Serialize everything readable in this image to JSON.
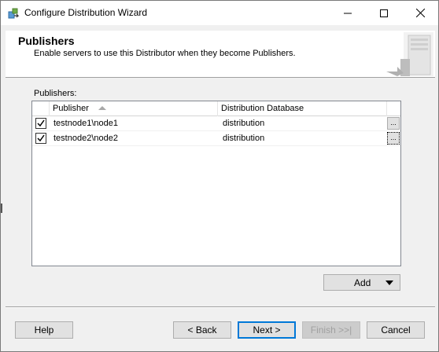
{
  "window": {
    "title": "Configure Distribution Wizard",
    "controls": [
      "minimize",
      "maximize",
      "close"
    ]
  },
  "header": {
    "title": "Publishers",
    "subtitle": "Enable servers to use this Distributor when they become Publishers."
  },
  "publishers_label": "Publishers:",
  "grid": {
    "columns": [
      "Publisher",
      "Distribution Database"
    ],
    "sort_column": "Publisher",
    "sort_direction": "ascending",
    "rows": [
      {
        "checked": true,
        "publisher": "testnode1\\node1",
        "database": "distribution",
        "ellipsis": "..."
      },
      {
        "checked": true,
        "publisher": "testnode2\\node2",
        "database": "distribution",
        "ellipsis": "..."
      }
    ]
  },
  "add_button": {
    "label": "Add"
  },
  "buttons": {
    "help": "Help",
    "back": "< Back",
    "next": "Next >",
    "finish": "Finish >>|",
    "cancel": "Cancel"
  },
  "colors": {
    "accent": "#0078d7",
    "window_bg": "#f0f0f0",
    "button_bg": "#e1e1e1"
  },
  "icons": {
    "app": "wizard-icon",
    "header": "server-icon"
  }
}
